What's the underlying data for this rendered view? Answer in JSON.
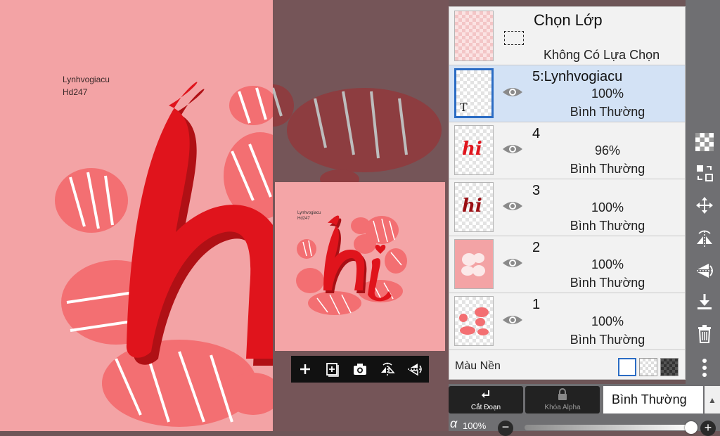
{
  "canvas": {
    "signature_line1": "Lynhvogiacu",
    "signature_line2": "Hd247"
  },
  "preview": {
    "signature_line1": "Lynhvogiacu",
    "signature_line2": "Hd247",
    "artwork_text": "hi"
  },
  "preview_toolbar": {
    "items": [
      "add-icon",
      "add-layer-image-icon",
      "camera-icon",
      "flip-horizontal-icon",
      "flip-vertical-icon"
    ]
  },
  "layer_panel": {
    "selection": {
      "title": "Chọn Lớp",
      "subtitle": "Không Có Lựa Chọn"
    },
    "layers": [
      {
        "name": "5:Lynhvogiacu",
        "opacity": "100%",
        "blend": "Bình Thường",
        "selected": true,
        "thumb_text": "T"
      },
      {
        "name": "4",
        "opacity": "96%",
        "blend": "Bình Thường",
        "selected": false,
        "thumb_text": "hi"
      },
      {
        "name": "3",
        "opacity": "100%",
        "blend": "Bình Thường",
        "selected": false,
        "thumb_text": "hi"
      },
      {
        "name": "2",
        "opacity": "100%",
        "blend": "Bình Thường",
        "selected": false,
        "thumb_text": ""
      },
      {
        "name": "1",
        "opacity": "100%",
        "blend": "Bình Thường",
        "selected": false,
        "thumb_text": ""
      }
    ],
    "background_label": "Màu Nền"
  },
  "bottom_bar": {
    "clip_label": "Cắt Đoạn",
    "alpha_lock_label": "Khóa Alpha",
    "blend_mode": "Bình Thường",
    "alpha_symbol": "α",
    "alpha_value": "100%",
    "alpha_fraction": 1.0
  },
  "colors": {
    "canvas_pink": "#f3a3a5",
    "accent_red": "#d8131b",
    "selection_blue": "#2b6cc4",
    "selected_row": "#d3e2f5"
  }
}
